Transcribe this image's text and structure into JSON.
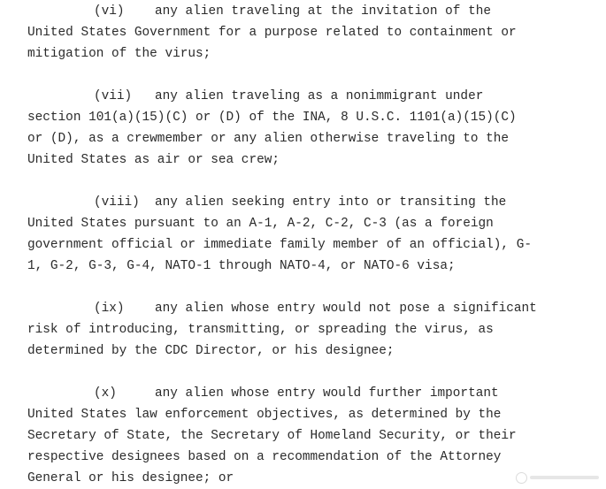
{
  "clauses": [
    {
      "number": "(vi)",
      "first_line": "any alien traveling at the invitation of the",
      "lines": [
        "United States Government for a purpose related to containment or",
        "mitigation of the virus;"
      ]
    },
    {
      "number": "(vii)",
      "first_line": "any alien traveling as a nonimmigrant under",
      "lines": [
        "section 101(a)(15)(C) or (D) of the INA, 8 U.S.C. 1101(a)(15)(C)",
        "or (D), as a crewmember or any alien otherwise traveling to the",
        "United States as air or sea crew;"
      ]
    },
    {
      "number": "(viii)",
      "first_line": "any alien seeking entry into or transiting the",
      "lines": [
        "United States pursuant to an A-1, A-2, C-2, C-3 (as a foreign",
        "government official or immediate family member of an official), G-",
        "1, G-2, G-3, G-4, NATO-1 through NATO-4, or NATO-6 visa;"
      ]
    },
    {
      "number": "(ix)",
      "first_line": "any alien whose entry would not pose a significant",
      "lines": [
        "risk of introducing, transmitting, or spreading the virus, as",
        "determined by the CDC Director, or his designee;"
      ]
    },
    {
      "number": "(x)",
      "first_line": "any alien whose entry would further important",
      "lines": [
        "United States law enforcement objectives, as determined by the",
        "Secretary of State, the Secretary of Homeland Security, or their",
        "respective designees based on a recommendation of the Attorney",
        "General or his designee; or"
      ]
    }
  ]
}
